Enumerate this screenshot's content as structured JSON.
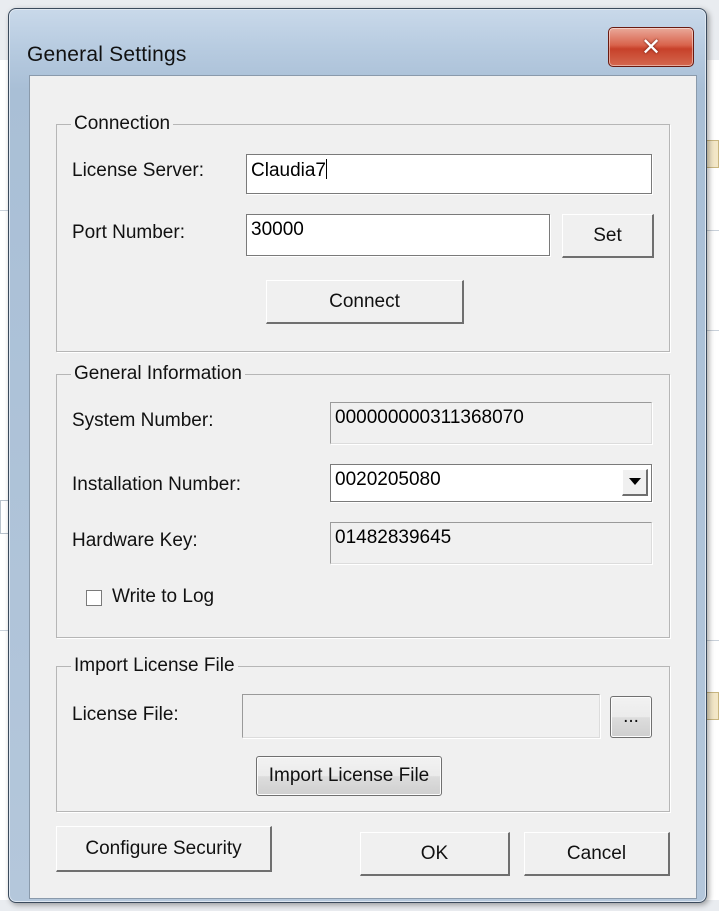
{
  "window": {
    "title": "General Settings",
    "close_glyph": "✕"
  },
  "connection": {
    "group_label": "Connection",
    "license_server_label": "License Server:",
    "license_server_value": "Claudia7",
    "port_label": "Port Number:",
    "port_value": "30000",
    "set_button": "Set",
    "connect_button": "Connect"
  },
  "general_info": {
    "group_label": "General Information",
    "system_number_label": "System Number:",
    "system_number_value": "000000000311368070",
    "installation_number_label": "Installation Number:",
    "installation_number_value": "0020205080",
    "hardware_key_label": "Hardware Key:",
    "hardware_key_value": "01482839645",
    "write_to_log_label": "Write to Log",
    "write_to_log_checked": false
  },
  "import_license": {
    "group_label": "Import License File",
    "license_file_label": "License File:",
    "license_file_value": "",
    "browse_button": "...",
    "import_button": "Import License File"
  },
  "footer": {
    "configure_security_button": "Configure Security",
    "ok_button": "OK",
    "cancel_button": "Cancel"
  },
  "icons": {
    "dropdown": "chevron-down-icon",
    "close": "close-icon"
  },
  "colors": {
    "close_button": "#c7412a",
    "title_bar": "#b7cbe0",
    "dialog_face": "#f0f0f0"
  }
}
